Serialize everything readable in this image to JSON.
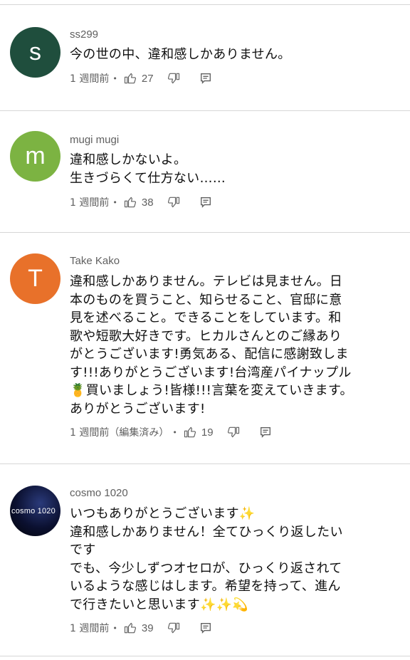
{
  "comments": [
    {
      "author": "ss299",
      "avatar_letter": "s",
      "avatar_color": "#1f4e3d",
      "text": "今の世の中、違和感しかありません。",
      "time": "1 週間前",
      "likes": "27"
    },
    {
      "author": "mugi mugi",
      "avatar_letter": "m",
      "avatar_color": "#7cb342",
      "text": "違和感しかないよ。\n生きづらくて仕方ない……",
      "time": "1 週間前",
      "likes": "38"
    },
    {
      "author": "Take Kako",
      "avatar_letter": "T",
      "avatar_color": "#e8712a",
      "text": "違和感しかありません。テレビは見ません。日\n本のものを買うこと、知らせること、官邸に意\n見を述べること。できることをしています。和\n歌や短歌大好きです。ヒカルさんとのご縁あり\nがとうございます!勇気ある、配信に感謝致しま\nす!!!ありがとうございます!台湾産パイナップル\n🍍買いましょう!皆様!!!言葉を変えていきます。\nありがとうございます!",
      "time": "1 週間前（編集済み）",
      "likes": "19"
    },
    {
      "author": "cosmo 1020",
      "avatar_letter": "cosmo 1020",
      "avatar_color": "#0b1030",
      "text": "いつもありがとうございます✨\n違和感しかありません！全てひっくり返したい\nです\nでも、今少しずつオセロが、ひっくり返されて\nいるような感じはします。希望を持って、進ん\nで行きたいと思います✨✨💫",
      "time": "1 週間前",
      "likes": "39"
    }
  ],
  "meta_separator": "•",
  "icons": {
    "like": "thumbs-up-icon",
    "dislike": "thumbs-down-icon",
    "reply": "reply-icon"
  }
}
